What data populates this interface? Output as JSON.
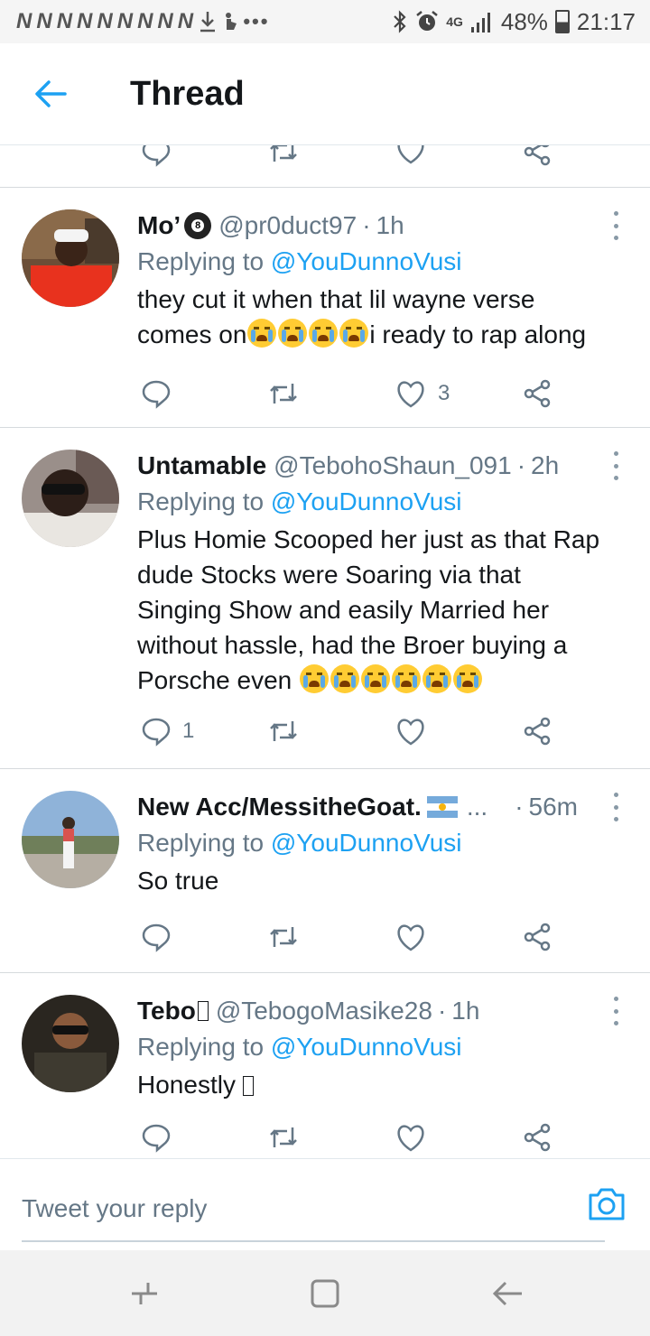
{
  "status_bar": {
    "left_icons": [
      "N",
      "N",
      "N",
      "N",
      "N",
      "N",
      "N",
      "N",
      "N"
    ],
    "network": "4G",
    "battery": "48%",
    "time": "21:17"
  },
  "app_bar": {
    "title": "Thread"
  },
  "tweets": [
    {
      "name": "Mo’",
      "name_suffix_icon": "8-ball-emoji",
      "handle": "@pr0duct97",
      "time": "1h",
      "replying_label": "Replying to",
      "replying_to": "@YouDunnoVusi",
      "text_lines": [
        "they cut it when that lil wayne verse",
        "comes on",
        "i ready to rap along"
      ],
      "emoji_count": 4,
      "reply_count": "",
      "like_count": "3"
    },
    {
      "name": "Untamable",
      "handle": "@TebohoShaun_091",
      "time": "2h",
      "replying_label": "Replying to",
      "replying_to": "@YouDunnoVusi",
      "text_lines": [
        "Plus Homie Scooped her just as that Rap",
        "dude Stocks were Soaring via that",
        "Singing Show and easily Married her",
        "without hassle, had the Broer buying a",
        "Porsche even "
      ],
      "emoji_count": 6,
      "reply_count": "1",
      "like_count": ""
    },
    {
      "name": "New Acc/MessitheGoat.",
      "name_suffix_icon": "argentina-flag",
      "name_ellipsis": "...",
      "handle": "",
      "time": "56m",
      "replying_label": "Replying to",
      "replying_to": "@YouDunnoVusi",
      "text": "So true",
      "reply_count": "",
      "like_count": ""
    },
    {
      "name": "Tebo",
      "name_suffix_icon": "missing-glyph",
      "handle": "@TebogoMasike28",
      "time": "1h",
      "replying_label": "Replying to",
      "replying_to": "@YouDunnoVusi",
      "text": "Honestly",
      "text_suffix_icon": "missing-glyph",
      "reply_count": "",
      "like_count": ""
    }
  ],
  "compose": {
    "placeholder": "Tweet your reply"
  },
  "colors": {
    "accent": "#1da1f2",
    "secondary_text": "#657786",
    "primary_text": "#14171a"
  }
}
